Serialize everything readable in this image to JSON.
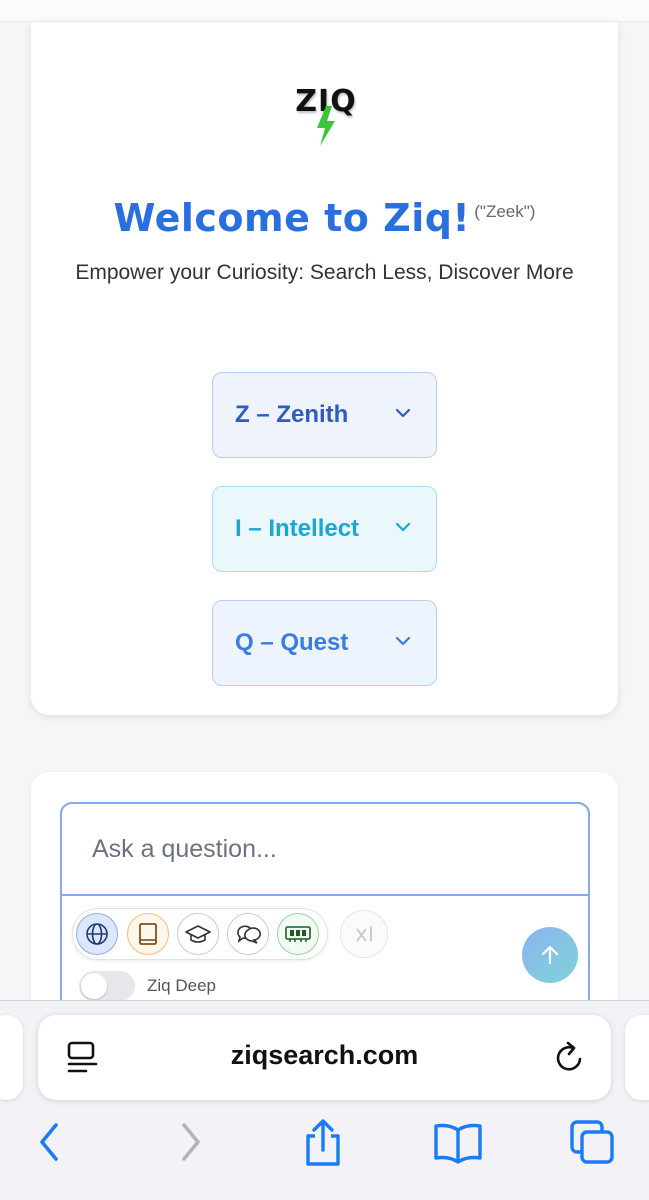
{
  "hero": {
    "logo_text": "ZIQ",
    "title": "Welcome to Ziq!",
    "pronunciation": "(\"Zeek\")",
    "tagline": "Empower your Curiosity: Search Less, Discover More"
  },
  "accordion": [
    {
      "label": "Z – Zenith"
    },
    {
      "label": "I – Intellect"
    },
    {
      "label": "Q – Quest"
    }
  ],
  "search": {
    "placeholder": "Ask a question...",
    "tools": [
      "globe-icon",
      "book-icon",
      "graduation-cap-icon",
      "chat-bubbles-icon",
      "memory-chip-icon"
    ],
    "model_icon": "xai-icon",
    "deep_toggle_label": "Ziq Deep",
    "deep_toggle_on": false
  },
  "browser": {
    "url": "ziqsearch.com"
  },
  "colors": {
    "title_blue": "#2a6fe0",
    "zenith": "#2d5cc4",
    "intellect": "#1ba6d6",
    "quest": "#3a7de0",
    "ios_blue": "#1a7cf5",
    "bolt_green": "#3cc43c"
  }
}
